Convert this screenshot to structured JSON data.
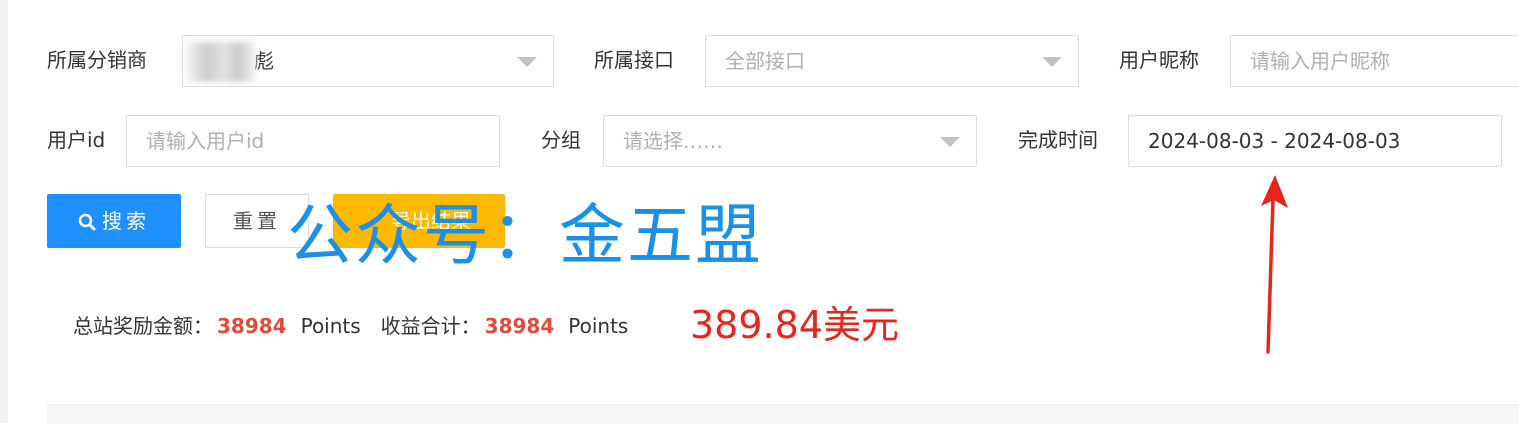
{
  "filters": {
    "distributor": {
      "label": "所属分销商",
      "value": "彪"
    },
    "interface": {
      "label": "所属接口",
      "placeholder": "全部接口"
    },
    "nickname": {
      "label": "用户昵称",
      "placeholder": "请输入用户昵称"
    },
    "user_id": {
      "label": "用户id",
      "placeholder": "请输入用户id"
    },
    "group": {
      "label": "分组",
      "placeholder": "请选择……"
    },
    "finish_time": {
      "label": "完成时间",
      "value": "2024-08-03 - 2024-08-03"
    }
  },
  "buttons": {
    "search": "搜索",
    "reset": "重置",
    "export": "导出结果"
  },
  "summary": {
    "total_reward_label": "总站奖励金额：",
    "total_reward_value": "38984",
    "total_reward_unit": "Points",
    "income_label": "收益合计：",
    "income_value": "38984",
    "income_unit": "Points",
    "usd_annotation": "389.84美元"
  },
  "watermark": "公众号：金五盟",
  "colors": {
    "primary": "#1e90ff",
    "warning": "#ffb800",
    "highlight_number": "#e24a3b",
    "annotation_red": "#e8251b",
    "watermark_blue": "#1a90e8"
  }
}
